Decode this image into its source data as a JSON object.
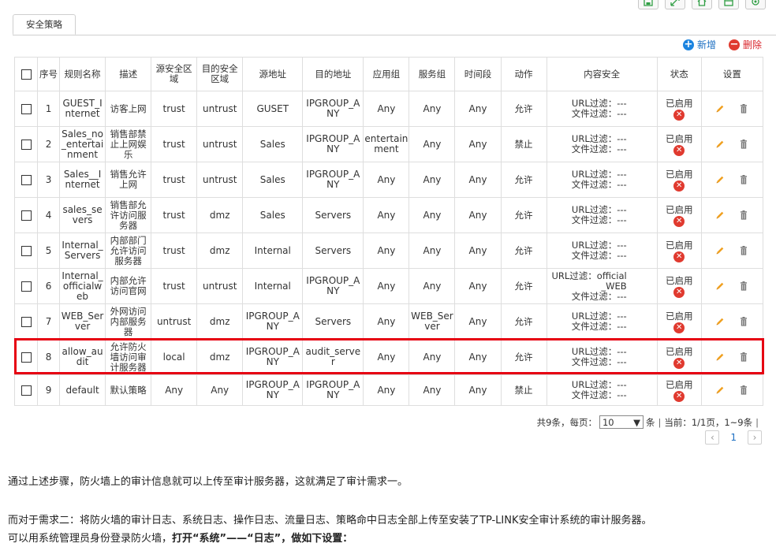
{
  "toolbar": {
    "icons": [
      "save-icon",
      "expand-icon",
      "home-icon",
      "window-icon",
      "settings-icon"
    ]
  },
  "tabs": [
    {
      "label": "安全策略",
      "active": true
    }
  ],
  "actions": {
    "add_label": "新增",
    "delete_label": "删除"
  },
  "table": {
    "headers": [
      "序号",
      "规则名称",
      "描述",
      "源安全区域",
      "目的安全区域",
      "源地址",
      "目的地址",
      "应用组",
      "服务组",
      "时间段",
      "动作",
      "内容安全",
      "状态",
      "设置"
    ],
    "url_prefix": "URL过滤：",
    "file_prefix": "文件过滤：",
    "rows": [
      {
        "no": "1",
        "name": "GUEST_Internet",
        "desc": "访客上网",
        "src_zone": "trust",
        "dst_zone": "untrust",
        "src_addr": "GUSET",
        "dst_addr": "IPGROUP_ANY",
        "app": "Any",
        "service": "Any",
        "time": "Any",
        "action": "允许",
        "url": "---",
        "file": "---",
        "status": "已启用"
      },
      {
        "no": "2",
        "name": "Sales_no_entertainment",
        "desc": "销售部禁止上网娱乐",
        "src_zone": "trust",
        "dst_zone": "untrust",
        "src_addr": "Sales",
        "dst_addr": "IPGROUP_ANY",
        "app": "entertainment",
        "service": "Any",
        "time": "Any",
        "action": "禁止",
        "url": "---",
        "file": "---",
        "status": "已启用"
      },
      {
        "no": "3",
        "name": "Sales__Internet",
        "desc": "销售允许上网",
        "src_zone": "trust",
        "dst_zone": "untrust",
        "src_addr": "Sales",
        "dst_addr": "IPGROUP_ANY",
        "app": "Any",
        "service": "Any",
        "time": "Any",
        "action": "允许",
        "url": "---",
        "file": "---",
        "status": "已启用"
      },
      {
        "no": "4",
        "name": "sales_severs",
        "desc": "销售部允许访问服务器",
        "src_zone": "trust",
        "dst_zone": "dmz",
        "src_addr": "Sales",
        "dst_addr": "Servers",
        "app": "Any",
        "service": "Any",
        "time": "Any",
        "action": "允许",
        "url": "---",
        "file": "---",
        "status": "已启用"
      },
      {
        "no": "5",
        "name": "Internal_Servers",
        "desc": "内部部门允许访问服务器",
        "src_zone": "trust",
        "dst_zone": "dmz",
        "src_addr": "Internal",
        "dst_addr": "Servers",
        "app": "Any",
        "service": "Any",
        "time": "Any",
        "action": "允许",
        "url": "---",
        "file": "---",
        "status": "已启用"
      },
      {
        "no": "6",
        "name": "Internal_officialweb",
        "desc": "内部允许访问官网",
        "src_zone": "trust",
        "dst_zone": "untrust",
        "src_addr": "Internal",
        "dst_addr": "IPGROUP_ANY",
        "app": "Any",
        "service": "Any",
        "time": "Any",
        "action": "允许",
        "url": "official_WEB",
        "file": "---",
        "status": "已启用"
      },
      {
        "no": "7",
        "name": "WEB_Server",
        "desc": "外网访问内部服务器",
        "src_zone": "untrust",
        "dst_zone": "dmz",
        "src_addr": "IPGROUP_ANY",
        "dst_addr": "Servers",
        "app": "Any",
        "service": "WEB_Server",
        "time": "Any",
        "action": "允许",
        "url": "---",
        "file": "---",
        "status": "已启用"
      },
      {
        "no": "8",
        "name": "allow_audit",
        "desc": "允许防火墙访问审计服务器",
        "src_zone": "local",
        "dst_zone": "dmz",
        "src_addr": "IPGROUP_ANY",
        "dst_addr": "audit_server",
        "app": "Any",
        "service": "Any",
        "time": "Any",
        "action": "允许",
        "url": "---",
        "file": "---",
        "status": "已启用",
        "highlighted": true
      },
      {
        "no": "9",
        "name": "default",
        "desc": "默认策略",
        "src_zone": "Any",
        "dst_zone": "Any",
        "src_addr": "IPGROUP_ANY",
        "dst_addr": "IPGROUP_ANY",
        "app": "Any",
        "service": "Any",
        "time": "Any",
        "action": "禁止",
        "url": "---",
        "file": "---",
        "status": "已启用"
      }
    ]
  },
  "pagination": {
    "total_label": "共9条，每页：",
    "per_page": "10",
    "unit_label": "条",
    "current_label": "当前：1/1页，1~9条",
    "current_page": "1"
  },
  "paragraphs": {
    "p1": "通过上述步骤，防火墙上的审计信息就可以上传至审计服务器，这就满足了审计需求一。",
    "p2": "而对于需求二：将防火墙的审计日志、系统日志、操作日志、流量日志、策略命中日志全部上传至安装了TP-LINK安全审计系统的审计服务器。",
    "p3_normal": "可以用系统管理员身份登录防火墙，",
    "p3_bold": "打开“系统”——“日志”，做如下设置："
  },
  "colors": {
    "highlight_border": "#e60012",
    "add_blue": "#1c84e0",
    "delete_red": "#e03a2f",
    "status_icon_red": "#e03a2f",
    "edit_icon_orange": "#f0a020",
    "trash_icon_gray": "#777777"
  }
}
